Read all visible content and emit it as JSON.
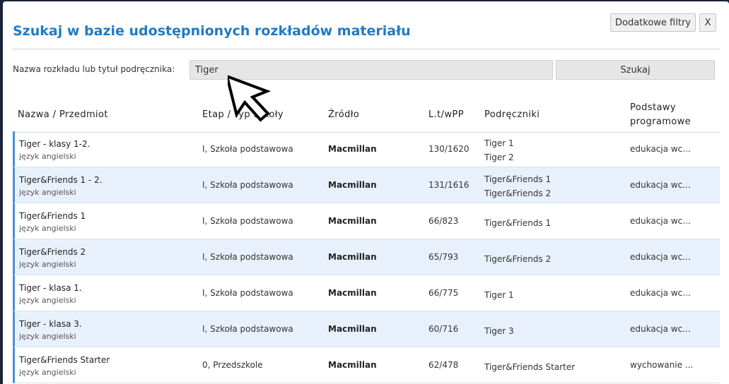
{
  "dialog": {
    "title": "Szukaj w bazie udostępnionych rozkładów materiału",
    "filters_button": "Dodatkowe filtry",
    "close_button": "X"
  },
  "search": {
    "label": "Nazwa rozkładu lub tytuł podręcznika:",
    "value": "Tiger",
    "button": "Szukaj"
  },
  "table": {
    "headers": {
      "name": "Nazwa / Przedmiot",
      "etap": "Etap / Typ szkoły",
      "source": "Źródło",
      "lt": "L.t/wPP",
      "books": "Podręczniki",
      "pp_line1": "Podstawy",
      "pp_line2": "programowe"
    },
    "rows": [
      {
        "name": "Tiger - klasy 1-2.",
        "subject": "język angielski",
        "etap": "I, Szkoła podstawowa",
        "source": "Macmillan",
        "lt": "130/1620",
        "books": [
          "Tiger 1",
          "Tiger 2"
        ],
        "pp": "edukacja wc..."
      },
      {
        "name": "Tiger&Friends 1 - 2.",
        "subject": "język angielski",
        "etap": "I, Szkoła podstawowa",
        "source": "Macmillan",
        "lt": "131/1616",
        "books": [
          "Tiger&Friends 1",
          "Tiger&Friends 2"
        ],
        "pp": "edukacja wc..."
      },
      {
        "name": "Tiger&Friends 1",
        "subject": "język angielski",
        "etap": "I, Szkoła podstawowa",
        "source": "Macmillan",
        "lt": "66/823",
        "books": [
          "Tiger&Friends 1"
        ],
        "pp": "edukacja wc..."
      },
      {
        "name": "Tiger&Friends 2",
        "subject": "język angielski",
        "etap": "I, Szkoła podstawowa",
        "source": "Macmillan",
        "lt": "65/793",
        "books": [
          "Tiger&Friends 2"
        ],
        "pp": "edukacja wc..."
      },
      {
        "name": "Tiger - klasa 1.",
        "subject": "język angielski",
        "etap": "I, Szkoła podstawowa",
        "source": "Macmillan",
        "lt": "66/775",
        "books": [
          "Tiger 1"
        ],
        "pp": "edukacja wc..."
      },
      {
        "name": "Tiger - klasa 3.",
        "subject": "język angielski",
        "etap": "I, Szkoła podstawowa",
        "source": "Macmillan",
        "lt": "60/716",
        "books": [
          "Tiger 3"
        ],
        "pp": "edukacja wc..."
      },
      {
        "name": "Tiger&Friends Starter",
        "subject": "język angielski",
        "etap": "0, Przedszkole",
        "source": "Macmillan",
        "lt": "62/478",
        "books": [
          "Tiger&Friends Starter"
        ],
        "pp": "wychowanie ..."
      }
    ]
  },
  "colors": {
    "title": "#1f7bc4",
    "row_alt": "#e8f1fb",
    "row_accent": "#4a8fd8"
  }
}
